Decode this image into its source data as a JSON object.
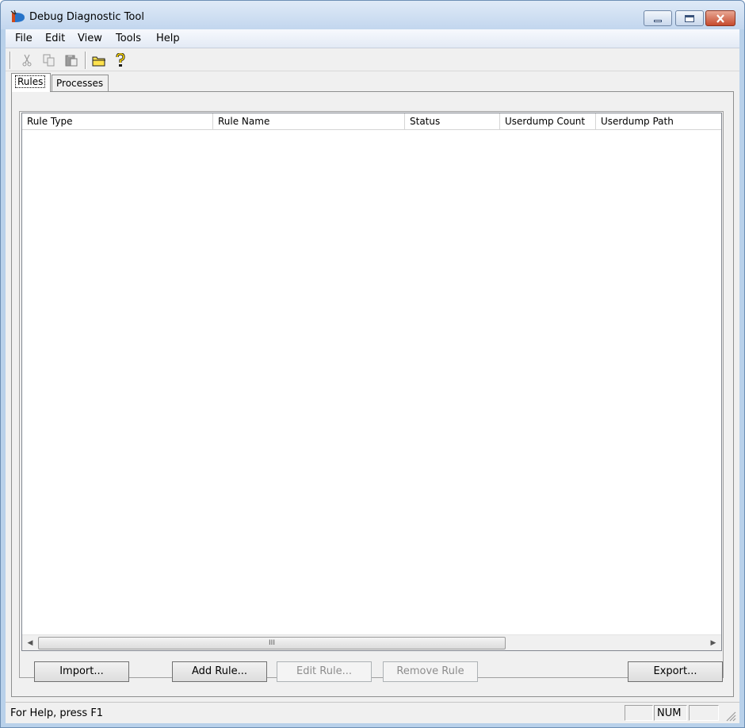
{
  "window": {
    "title": "Debug Diagnostic Tool"
  },
  "menu": {
    "items": [
      "File",
      "Edit",
      "View",
      "Tools",
      "Help"
    ]
  },
  "toolbar": {
    "icons": [
      "cut-icon",
      "copy-icon",
      "paste-icon",
      "open-folder-icon",
      "help-icon"
    ]
  },
  "tabs": [
    {
      "label": "Rules",
      "selected": true
    },
    {
      "label": "Processes",
      "selected": false
    }
  ],
  "rules_list": {
    "columns": [
      "Rule Type",
      "Rule Name",
      "Status",
      "Userdump Count",
      "Userdump Path"
    ],
    "rows": [],
    "scroll_thumb_glyph": "III"
  },
  "buttons": {
    "import": "Import...",
    "add_rule": "Add Rule...",
    "edit_rule": "Edit Rule...",
    "remove_rule": "Remove Rule",
    "export": "Export..."
  },
  "status": {
    "help_text": "For Help, press F1",
    "num_indicator": "NUM"
  },
  "colors": {
    "title_bar": "#c2d6ee",
    "close_button": "#c64b2e",
    "client_bg": "#f0f0f0"
  }
}
